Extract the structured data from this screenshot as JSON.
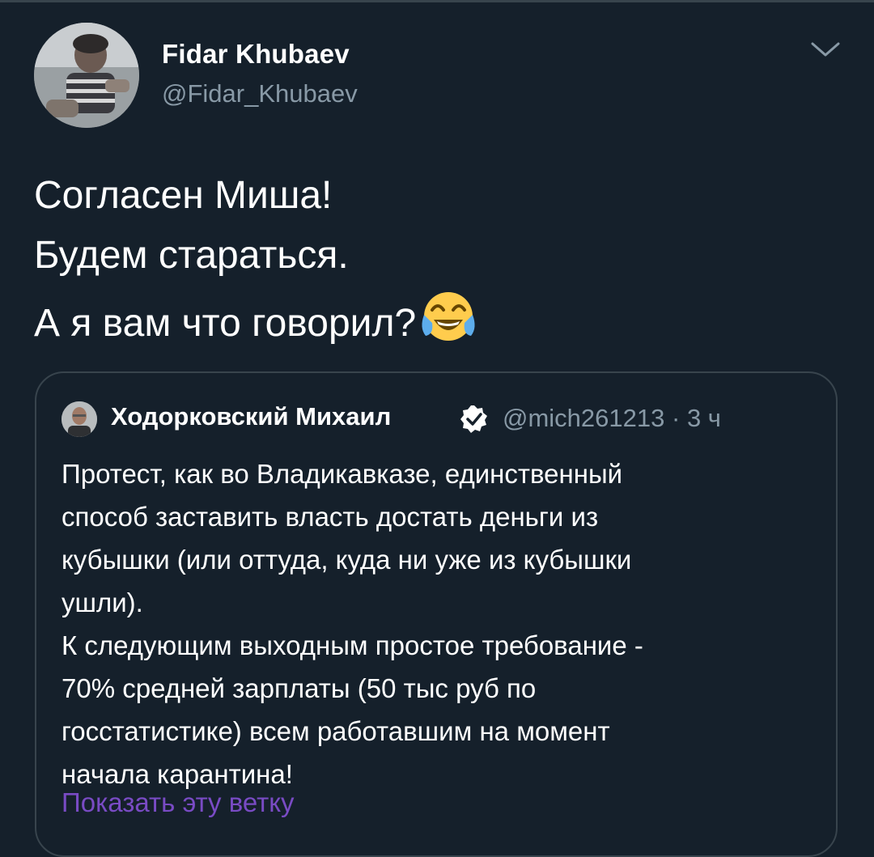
{
  "tweet": {
    "author": {
      "display_name": "Fidar Khubaev",
      "handle": "@Fidar_Khubaev",
      "avatar": "user-photo-avatar"
    },
    "menu_icon": "chevron-down-icon",
    "lines": [
      "Согласен Миша!",
      "Будем стараться.",
      "А я вам что говорил?"
    ],
    "emoji": "face-with-tears-of-joy-emoji"
  },
  "quoted_tweet": {
    "author": {
      "display_name": "Ходорковский Михаил",
      "verified_icon": "verified-badge-icon",
      "handle": "@mich261213",
      "separator": "·",
      "time": "3 ч"
    },
    "lines": [
      "Протест, как во Владикавказе, единственный",
      "способ заставить власть достать деньги из",
      "кубышки (или оттуда, куда ни уже из кубышки",
      "ушли).",
      "К следующим выходным простое требование -",
      "70% средней зарплаты (50 тыс руб по",
      "госстатистике)  всем работавшим на момент",
      "начала карантина!"
    ],
    "show_thread_label": "Показать эту ветку"
  },
  "colors": {
    "background": "#15202b",
    "border": "#38444d",
    "secondary_text": "#8899a6",
    "link": "#794bc4",
    "verified": "#ffffff"
  }
}
